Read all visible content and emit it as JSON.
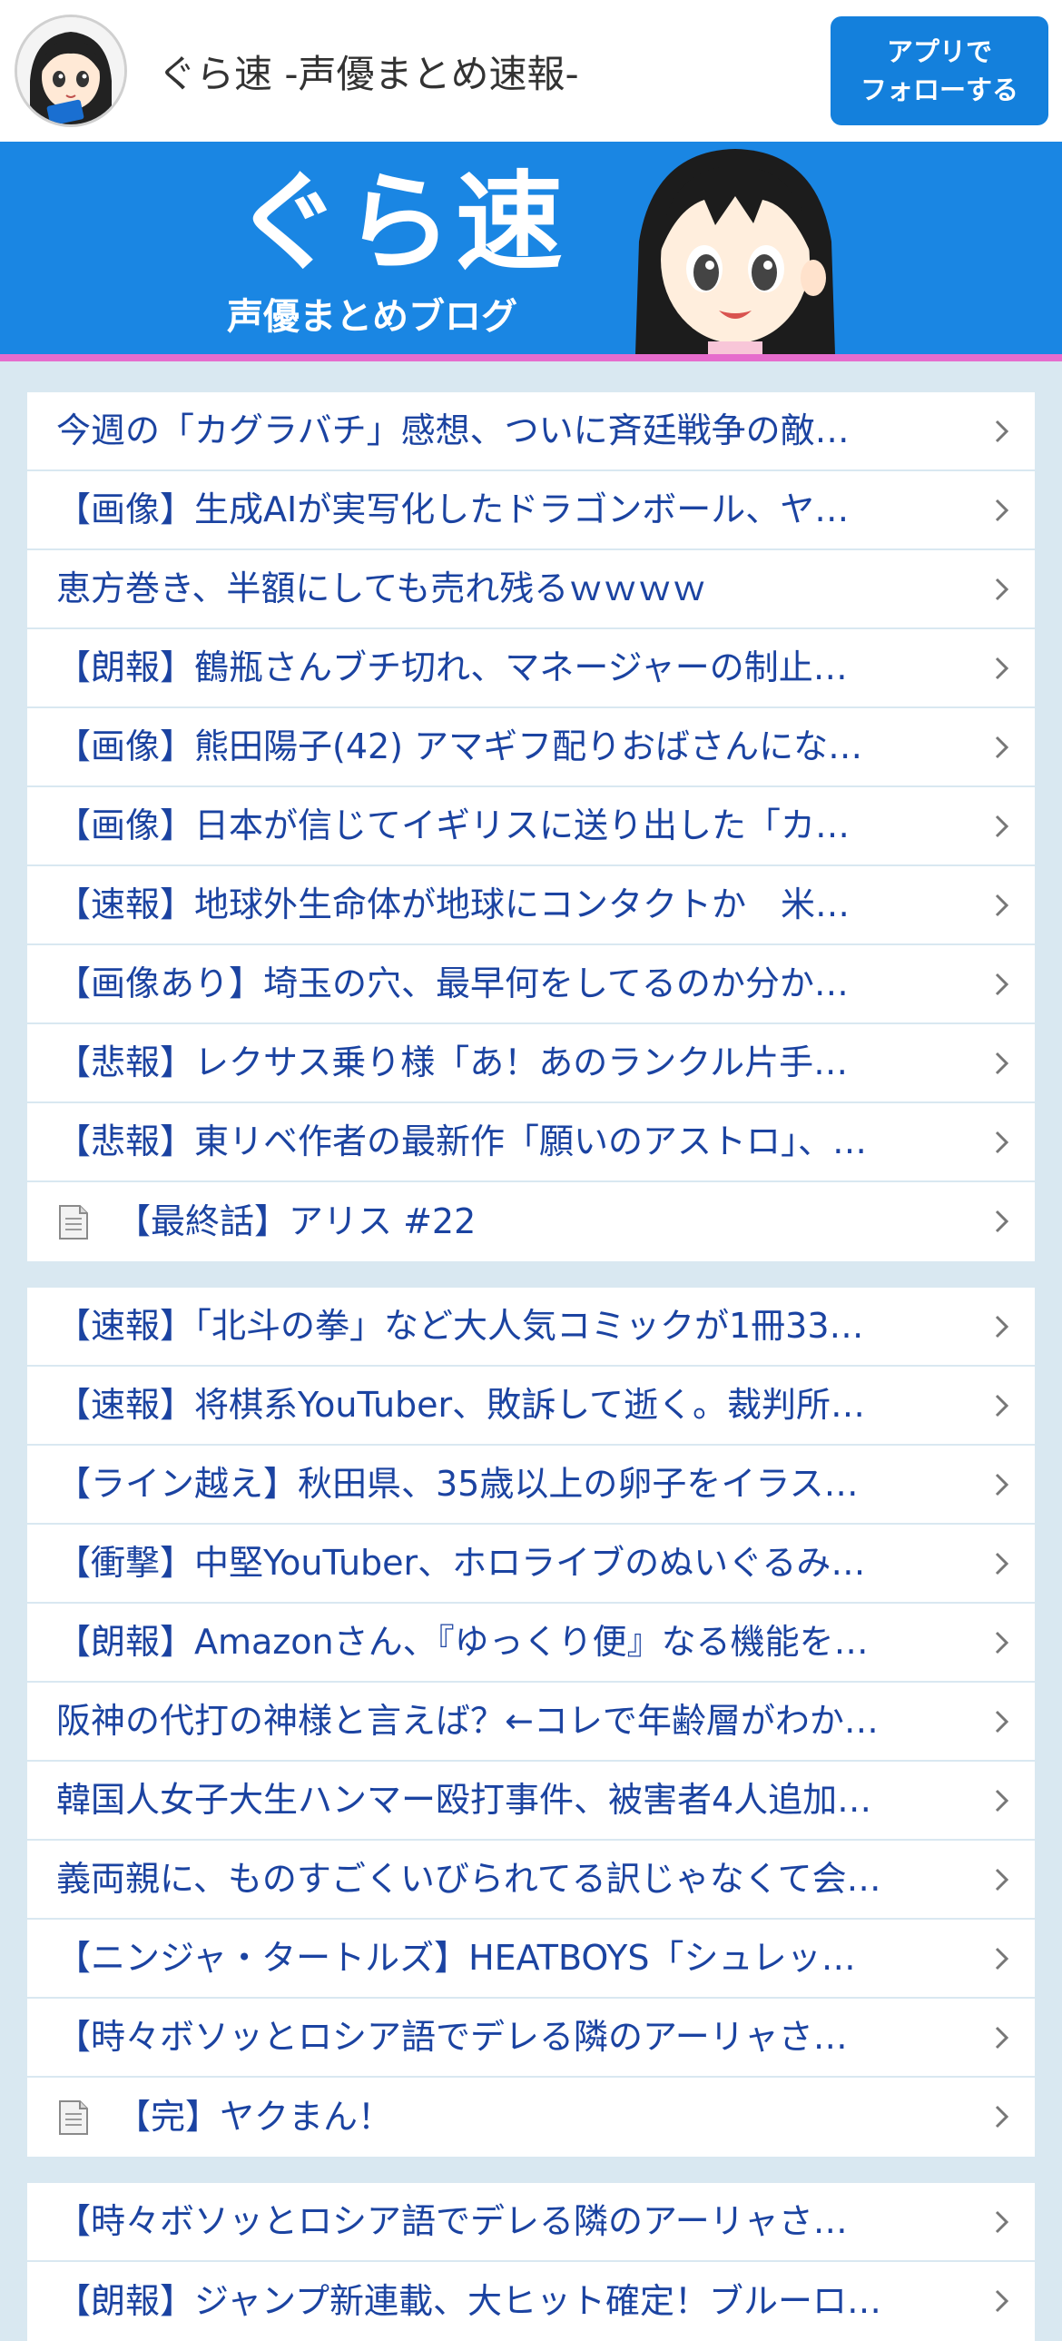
{
  "header": {
    "site_title": "ぐら速 -声優まとめ速報-",
    "follow_button": [
      "アプリで",
      "フォローする"
    ]
  },
  "banner": {
    "logo_text": "ぐら速",
    "subtitle": "声優まとめブログ"
  },
  "colors": {
    "accent": "#1480dc",
    "banner_bg": "#1a86e3",
    "banner_stripe": "#e66ccd",
    "link_text": "#1b43a1",
    "page_bg": "#d9e8f1"
  },
  "lists": [
    {
      "items": [
        {
          "text": "今週の「カグラバチ」感想、ついに斉廷戦争の敵…",
          "icon": null
        },
        {
          "text": "【画像】生成AIが実写化したドラゴンボール、ヤ…",
          "icon": null
        },
        {
          "text": "恵方巻き、半額にしても売れ残るｗｗｗｗ",
          "icon": null
        },
        {
          "text": "【朗報】鶴瓶さんブチ切れ、マネージャーの制止…",
          "icon": null
        },
        {
          "text": "【画像】熊田陽子(42) アマギフ配りおばさんにな…",
          "icon": null
        },
        {
          "text": "【画像】日本が信じてイギリスに送り出した「カ…",
          "icon": null
        },
        {
          "text": "【速報】地球外生命体が地球にコンタクトか　米…",
          "icon": null
        },
        {
          "text": "【画像あり】埼玉の穴、最早何をしてるのか分か…",
          "icon": null
        },
        {
          "text": "【悲報】レクサス乗り様「あ！あのランクル片手…",
          "icon": null
        },
        {
          "text": "【悲報】東リベ作者の最新作「願いのアストロ」、…",
          "icon": null
        },
        {
          "text": "【最終話】アリス #22",
          "icon": "document-icon"
        }
      ]
    },
    {
      "items": [
        {
          "text": "【速報】「北斗の拳」など大人気コミックが1冊33…",
          "icon": null
        },
        {
          "text": "【速報】将棋系YouTuber、敗訴して逝く。裁判所…",
          "icon": null
        },
        {
          "text": "【ライン越え】秋田県、35歳以上の卵子をイラス…",
          "icon": null
        },
        {
          "text": "【衝撃】中堅YouTuber、ホロライブのぬいぐるみ…",
          "icon": null
        },
        {
          "text": "【朗報】Amazonさん、『ゆっくり便』なる機能を…",
          "icon": null
        },
        {
          "text": "阪神の代打の神様と言えば？←コレで年齢層がわか…",
          "icon": null
        },
        {
          "text": "韓国人女子大生ハンマー殴打事件、被害者4人追加…",
          "icon": null
        },
        {
          "text": "義両親に、ものすごくいびられてる訳じゃなくて会…",
          "icon": null
        },
        {
          "text": "【ニンジャ・タートルズ】HEATBOYS「シュレッ…",
          "icon": null
        },
        {
          "text": "【時々ボソッとロシア語でデレる隣のアーリャさ…",
          "icon": null
        },
        {
          "text": "【完】ヤクまん！",
          "icon": "document-icon"
        }
      ]
    },
    {
      "items": [
        {
          "text": "【時々ボソッとロシア語でデレる隣のアーリャさ…",
          "icon": null
        },
        {
          "text": "【朗報】ジャンプ新連載、大ヒット確定！ブルーロ…",
          "icon": null
        }
      ]
    }
  ]
}
